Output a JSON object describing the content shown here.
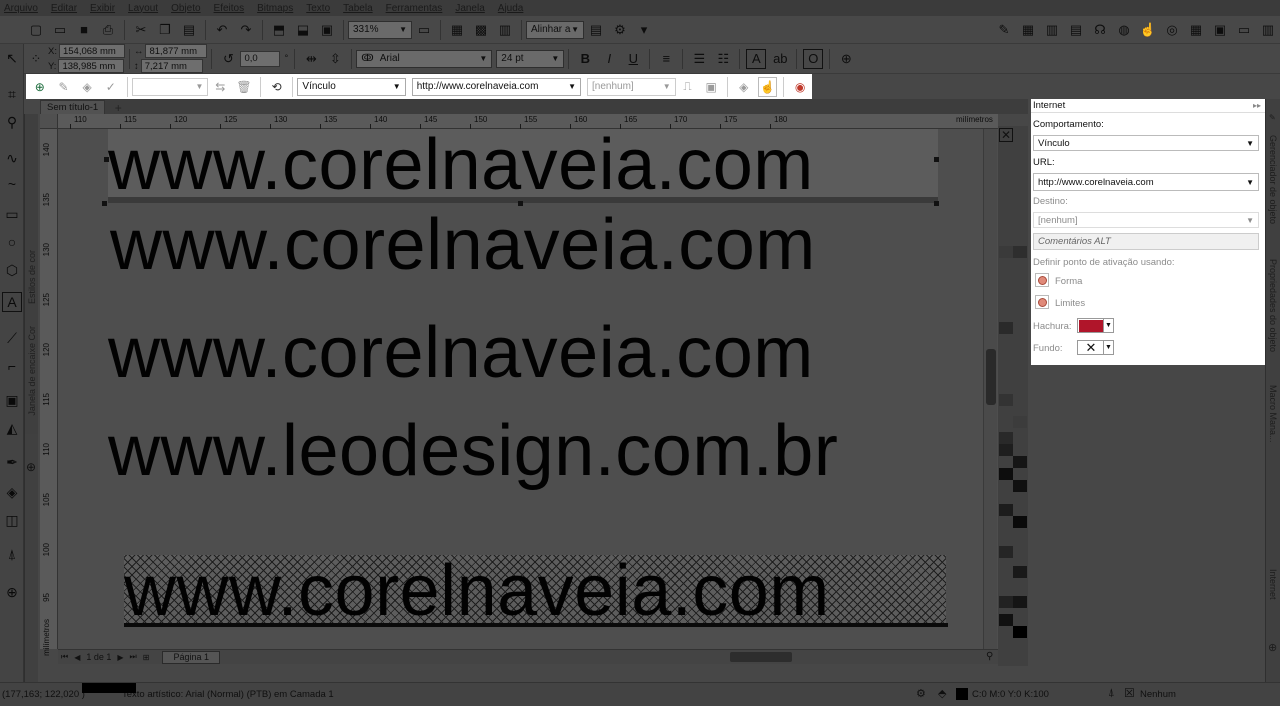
{
  "menu": [
    "Arquivo",
    "Editar",
    "Exibir",
    "Layout",
    "Objeto",
    "Efeitos",
    "Bitmaps",
    "Texto",
    "Tabela",
    "Ferramentas",
    "Janela",
    "Ajuda"
  ],
  "toolbar": {
    "zoom": "331%",
    "snap_label": "Alinhar a"
  },
  "propbar": {
    "x": "154,068 mm",
    "y": "138,985 mm",
    "width": "81,877 mm",
    "height": "7,217 mm",
    "rotation": "0,0",
    "degree_sign": "°",
    "font": "Arial",
    "font_size": "24 pt"
  },
  "internet_toolbar": {
    "behavior": "Vínculo",
    "url": "http://www.corelnaveia.com",
    "target": "[nenhum]"
  },
  "doc_tab": "Sem título-1",
  "hruler": {
    "labels": [
      "110",
      "115",
      "120",
      "125",
      "130",
      "135",
      "140",
      "145",
      "150",
      "155",
      "160",
      "165",
      "170",
      "175",
      "180"
    ],
    "unit": "milímetros"
  },
  "vruler": {
    "labels": [
      "140",
      "135",
      "130",
      "125",
      "120",
      "115",
      "110",
      "105",
      "100",
      "95"
    ],
    "unit": "milímetros"
  },
  "canvas": {
    "line1": "www.corelnaveia.com",
    "line2": "www.corelnaveia.com",
    "line3": "www.corelnaveia.com",
    "line4": "www.leodesign.com.br",
    "line5": "www.corelnaveia.com"
  },
  "nav": {
    "page_count": "1 de 1",
    "page_tab": "Página 1"
  },
  "status": {
    "coords": "(177,163; 122,020 )",
    "info": "Texto artístico: Arial (Normal) (PTB) em Camada 1",
    "fill": "C:0 M:0 Y:0 K:100",
    "outline": "Nenhum"
  },
  "left_tabs": [
    "Estilos de cor",
    "Janela de encaixe Cor"
  ],
  "docker": {
    "title": "Internet",
    "behavior_label": "Comportamento:",
    "behavior_value": "Vínculo",
    "url_label": "URL:",
    "url_value": "http://www.corelnaveia.com",
    "target_label": "Destino:",
    "target_value": "[nenhum]",
    "alt_comments": "Comentários ALT",
    "hotspot_label": "Definir ponto de ativação usando:",
    "option_shape": "Forma",
    "option_bounds": "Limites",
    "hatch_label": "Hachura:",
    "hatch_color": "#b0152a",
    "background_label": "Fundo:"
  },
  "right_tabs": [
    "Gerenciador de objeto",
    "Propriedades do objeto",
    "Macro Mana...",
    "Internet"
  ]
}
